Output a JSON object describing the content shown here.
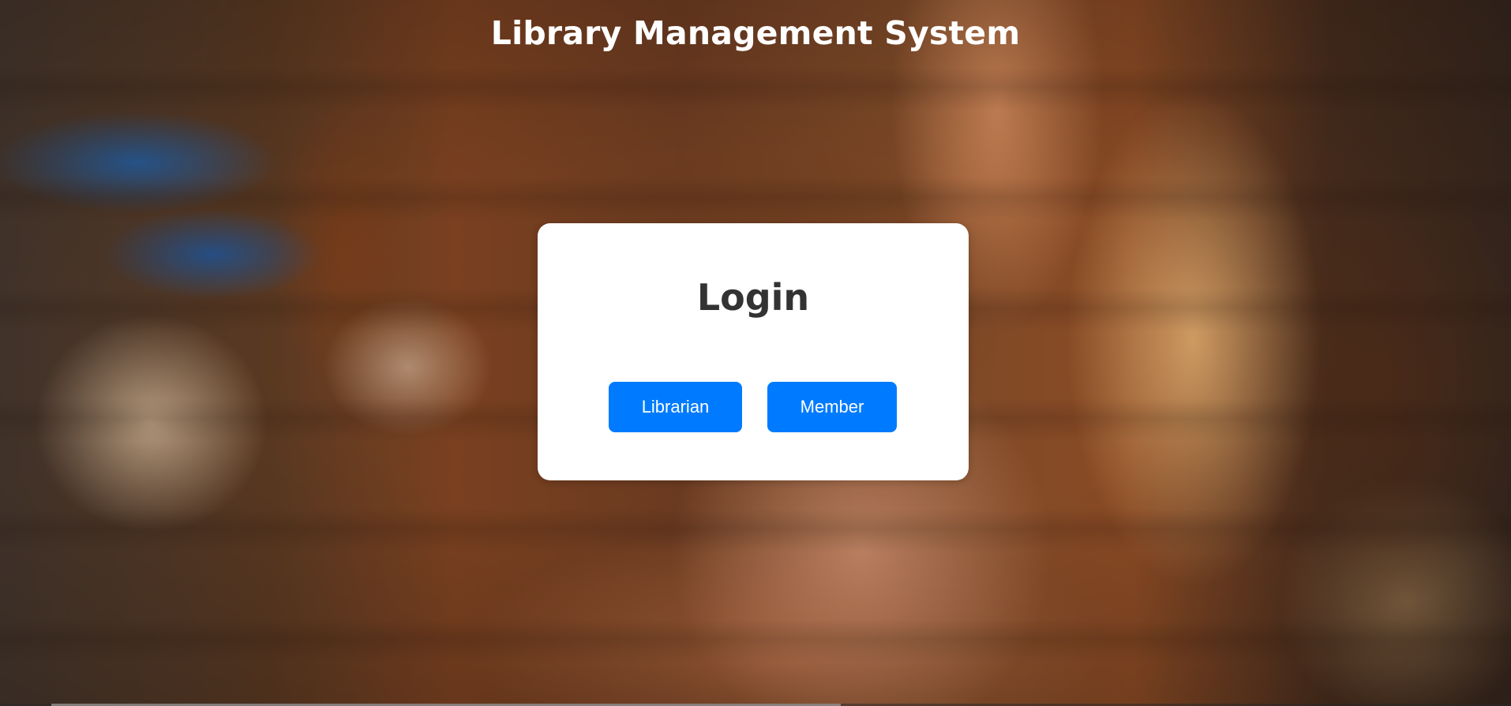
{
  "header": {
    "title": "Library Management System"
  },
  "login_card": {
    "title": "Login",
    "buttons": {
      "librarian_label": "Librarian",
      "member_label": "Member"
    }
  },
  "colors": {
    "button_primary": "#007bff",
    "card_background": "#ffffff",
    "title_text": "#ffffff",
    "card_title_text": "#333333"
  }
}
